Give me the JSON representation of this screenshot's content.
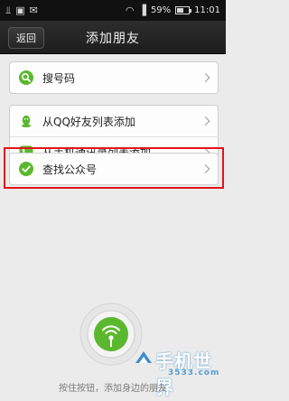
{
  "status_bar": {
    "battery_percent": "59%",
    "time": "11:01",
    "battery_level": 0.59,
    "left_icons": [
      "usb-icon",
      "image-icon",
      "notification-icon"
    ],
    "right_icons": [
      "wifi-icon",
      "signal-icon",
      "battery-icon"
    ]
  },
  "header": {
    "back_label": "返回",
    "title": "添加朋友"
  },
  "menu": {
    "search_number": "搜号码",
    "add_from_qq": "从QQ好友列表添加",
    "add_from_contacts": "从手机通讯录列表添加",
    "find_public_account": "查找公众号"
  },
  "footer": {
    "hint": "按住按钮，添加身边的朋友"
  },
  "watermark": {
    "text": "手机世界",
    "sub": "3533.com"
  },
  "colors": {
    "highlight": "#e3141b",
    "icon_green": "#5bb82e",
    "title_bar": "#222222"
  }
}
